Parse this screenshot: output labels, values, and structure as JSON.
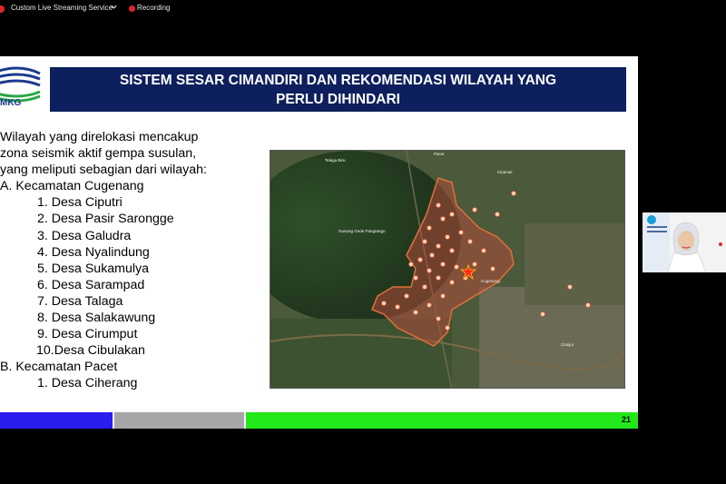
{
  "toolbar": {
    "stream_label": "Custom Live Streaming Service",
    "recording_label": "Recording",
    "colors": {
      "live": "#e0262b",
      "recording": "#e0262b"
    }
  },
  "slide": {
    "logo_text": "MKG",
    "title_line1": "SISTEM SESAR CIMANDIRI DAN REKOMENDASI WILAYAH YANG",
    "title_line2": "PERLU DIHINDARI",
    "intro": [
      "Wilayah yang direlokasi mencakup",
      "zona seismik aktif gempa susulan,",
      "yang meliputi sebagian dari wilayah:"
    ],
    "section_a": "A. Kecamatan Cugenang",
    "villages_a": [
      "1.  Desa Ciputri",
      "2.  Desa Pasir Sarongge",
      "3.  Desa Galudra",
      "4.  Desa Nyalindung",
      "5.  Desa Sukamulya",
      "6.  Desa Sarampad",
      "7.  Desa Talaga",
      "8.  Desa Salakawung",
      "9.  Desa Cirumput",
      "10.Desa Cibulakan"
    ],
    "section_b": "B. Kecamatan Pacet",
    "villages_b": [
      "1.  Desa Ciherang"
    ],
    "page_number": "21",
    "footer_colors": [
      "#2b1df0",
      "#a6a6a6",
      "#22e81a"
    ],
    "title_bg": "#0d1f5c"
  },
  "map": {
    "labels": [
      "Telaga Biru",
      "Gunung Gede Pangrango",
      "Cipanas",
      "Cianjur",
      "Pacet",
      "Cugenang"
    ]
  },
  "webcam": {
    "icon": "presenter-video"
  }
}
